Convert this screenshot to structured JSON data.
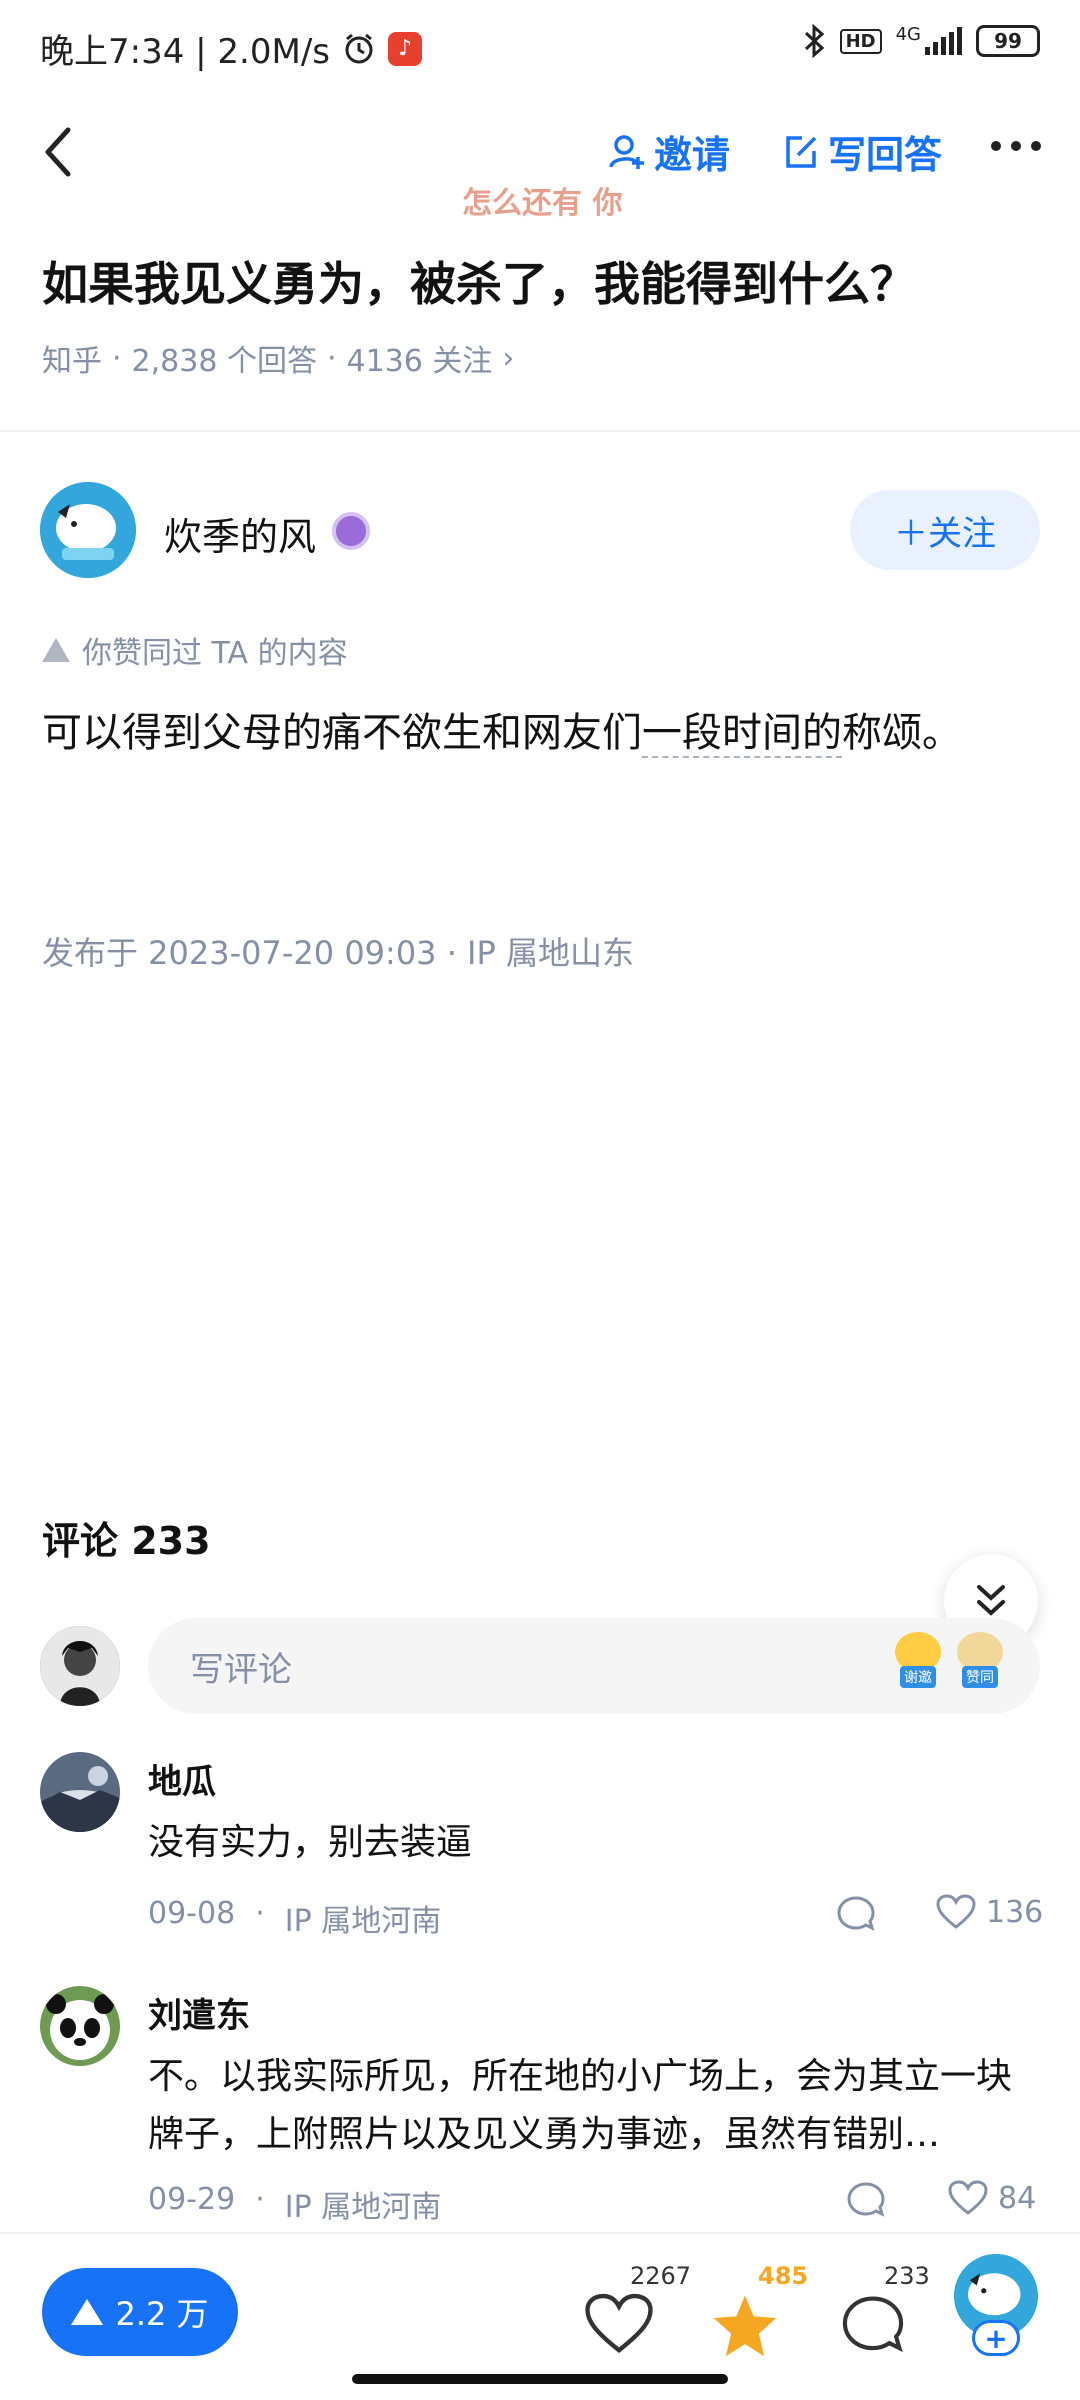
{
  "status_bar": {
    "time_speed": "晚上7:34 | 2.0M/s",
    "network": "4G",
    "hd": "HD",
    "battery": "99"
  },
  "nav": {
    "invite_label": "邀请",
    "write_answer_label": "写回答",
    "hint_overlay": "怎么还有 你"
  },
  "question": {
    "title": "如果我见义勇为，被杀了，我能得到什么？",
    "source": "知乎",
    "answers": "2,838 个回答",
    "follows": "4136 关注",
    "chevron": "›"
  },
  "author": {
    "name": "炊季的风",
    "follow_label": "＋关注"
  },
  "answer": {
    "liked_hint": "你赞同过 TA 的内容",
    "text_part1": "可以得到父母的痛不欲生和网友们",
    "text_dotted": "一段时间的",
    "text_part2": "称颂。",
    "publish_info": "发布于 2023-07-20 09:03 · IP 属地山东"
  },
  "comments_section": {
    "header": "评论 233",
    "input_placeholder": "写评论",
    "emoji_thanks": "谢邀",
    "emoji_agree": "赞同"
  },
  "comments": [
    {
      "name": "地瓜",
      "text": "没有实力，别去装逼",
      "date": "09-08",
      "ip": "IP 属地河南",
      "likes": "136"
    },
    {
      "name": "刘遣东",
      "text": "不。以我实际所见，所在地的小广场上，会为其立一块牌子，上附照片以及见义勇为事迹，虽然有错别…",
      "date": "09-29",
      "ip": "IP 属地河南",
      "likes": "84"
    }
  ],
  "bottom_bar": {
    "vote_count": "2.2 万",
    "like_count": "2267",
    "favorite_count": "485",
    "comment_count": "233",
    "plus": "+"
  },
  "colors": {
    "accent": "#1772f6",
    "favorite": "#f5a623",
    "meta": "#8590a6"
  }
}
